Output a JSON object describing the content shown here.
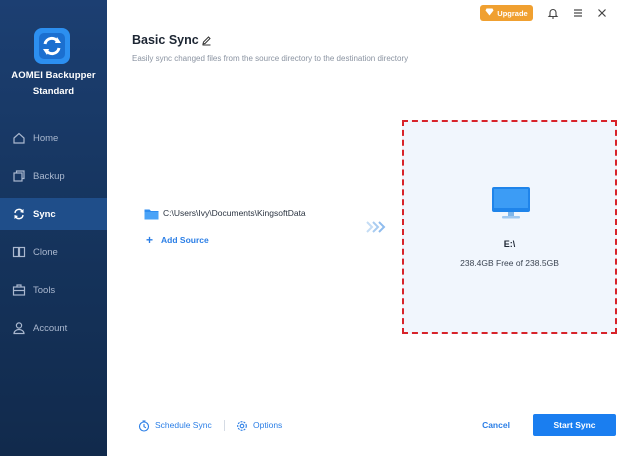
{
  "app": {
    "name": "AOMEI Backupper",
    "edition": "Standard"
  },
  "nav": {
    "items": [
      {
        "label": "Home",
        "icon": "home-icon"
      },
      {
        "label": "Backup",
        "icon": "backup-icon"
      },
      {
        "label": "Sync",
        "icon": "sync-icon",
        "active": true
      },
      {
        "label": "Clone",
        "icon": "clone-icon"
      },
      {
        "label": "Tools",
        "icon": "tools-icon"
      },
      {
        "label": "Account",
        "icon": "account-icon"
      }
    ]
  },
  "titlebar": {
    "upgrade_label": "Upgrade"
  },
  "header": {
    "title": "Basic Sync",
    "subtitle": "Easily sync changed files from the source directory to the destination directory"
  },
  "source": {
    "path": "C:\\Users\\Ivy\\Documents\\KingsoftData",
    "add_label": "Add Source"
  },
  "destination": {
    "drive": "E:\\",
    "space": "238.4GB Free of 238.5GB"
  },
  "footer": {
    "schedule_label": "Schedule Sync",
    "options_label": "Options",
    "cancel_label": "Cancel",
    "start_label": "Start Sync"
  },
  "colors": {
    "sidebar": "#16355f",
    "accent": "#1a7ef0",
    "upgrade": "#f0a030",
    "dest_border": "#d8232a"
  }
}
